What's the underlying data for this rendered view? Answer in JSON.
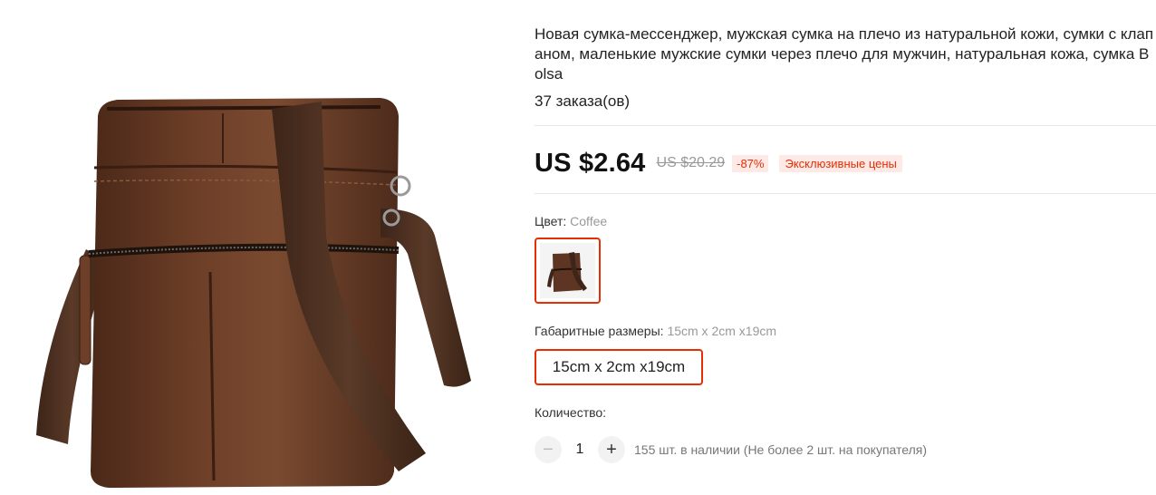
{
  "product": {
    "title": "Новая сумка-мессенджер, мужская сумка на плечо из натуральной кожи, сумки с клапаном, маленькие мужские сумки через плечо для мужчин, натуральная кожа, сумка Bolsa",
    "orders": "37 заказа(ов)",
    "image_alt": "brown-leather-messenger-bag-photo"
  },
  "price": {
    "current": "US $2.64",
    "original": "US $20.29",
    "discount": "-87%",
    "badge": "Эксклюзивные цены"
  },
  "color": {
    "label": "Цвет: ",
    "selected": "Coffee"
  },
  "size": {
    "label": "Габаритные размеры: ",
    "selected": "15cm x 2cm x19cm",
    "option": "15cm x 2cm x19cm"
  },
  "quantity": {
    "label": "Количество:",
    "minus": "−",
    "value": "1",
    "plus": "+",
    "stock": "155 шт. в наличии (Не более 2 шт. на покупателя)"
  },
  "colors": {
    "accent": "#e62e04",
    "badge_bg": "#fde9e5",
    "leather": "#5a3322",
    "strap": "#4a2e20"
  }
}
